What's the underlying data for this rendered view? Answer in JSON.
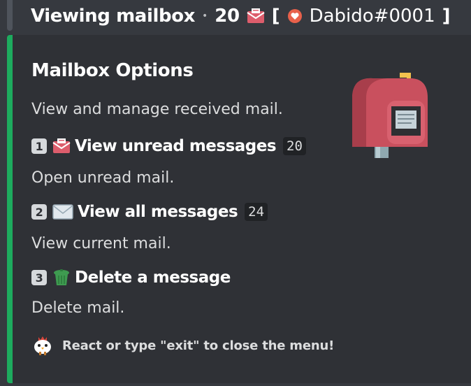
{
  "header": {
    "title": "Viewing mailbox",
    "separator": "•",
    "unread_count": "20",
    "bracket_open": "[",
    "username": "Dabido#0001",
    "bracket_close": "]"
  },
  "embed": {
    "accent_color": "#1dab5e",
    "title": "Mailbox Options",
    "description": "View and manage received mail.",
    "options": [
      {
        "key": "1",
        "icon": "unread-mail-icon",
        "label": "View unread messages",
        "count": "20",
        "subtext": "Open unread mail."
      },
      {
        "key": "2",
        "icon": "envelope-icon",
        "label": "View all messages",
        "count": "24",
        "subtext": "View current mail."
      },
      {
        "key": "3",
        "icon": "trash-can-icon",
        "label": "Delete a message",
        "subtext": "Delete mail."
      }
    ],
    "thumbnail_icon": "mailbox-icon",
    "footer": {
      "icon": "chicken-icon",
      "text": "React or type \"exit\" to close the menu!"
    }
  }
}
